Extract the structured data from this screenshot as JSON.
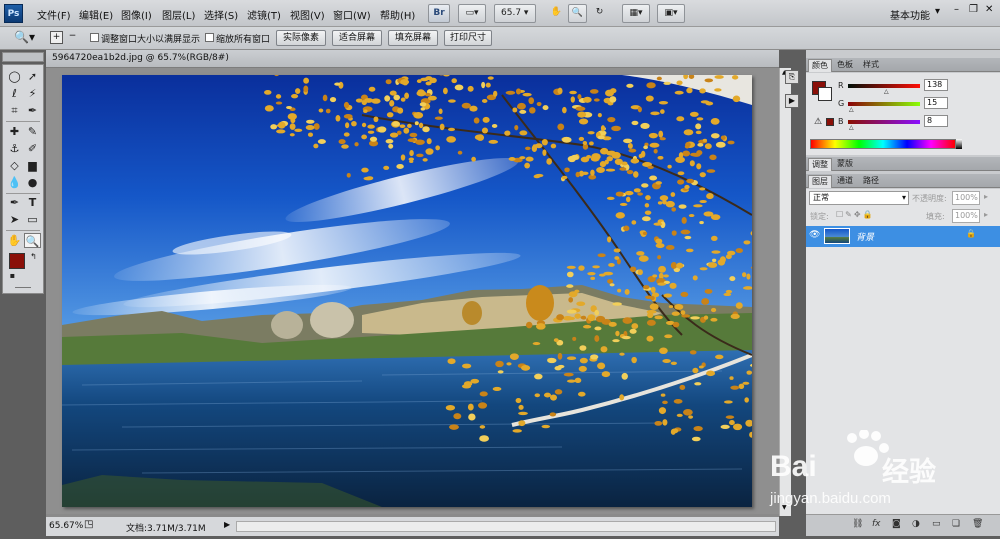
{
  "app": {
    "logo": "Ps"
  },
  "menu": [
    "文件(F)",
    "编辑(E)",
    "图像(I)",
    "图层(L)",
    "选择(S)",
    "滤镜(T)",
    "视图(V)",
    "窗口(W)",
    "帮助(H)"
  ],
  "appbar": {
    "bridge": "Br",
    "zoom": "65.7",
    "workspace": "基本功能"
  },
  "options": {
    "resize_windows": "调整窗口大小以满屏显示",
    "zoom_all": "缩放所有窗口",
    "actual_pixels": "实际像素",
    "fit_screen": "适合屏幕",
    "fill_screen": "填充屏幕",
    "print_size": "打印尺寸"
  },
  "document": {
    "tab_title": "5964720ea1b2d.jpg @ 65.7%(RGB/8#)"
  },
  "status": {
    "zoom": "65.67%",
    "doc": "文档:3.71M/3.71M"
  },
  "color_panel": {
    "tabs": [
      "颜色",
      "色板",
      "样式"
    ],
    "r_label": "R",
    "g_label": "G",
    "b_label": "B",
    "r": "138",
    "g": "15",
    "b": "8",
    "foreground": "#8a0f08"
  },
  "adjust_panel": {
    "tabs": [
      "调整",
      "蒙版"
    ]
  },
  "layers_panel": {
    "tabs": [
      "图层",
      "通道",
      "路径"
    ],
    "blend_mode": "正常",
    "opacity_label": "不透明度:",
    "opacity": "100%",
    "lock_label": "锁定:",
    "fill_label": "填充:",
    "fill": "100%",
    "layer_name": "背景"
  },
  "watermark": {
    "brand": "Bai",
    "brand2": "经验",
    "url": "jingyan.baidu.com"
  },
  "colors": {
    "accent": "#3399ff",
    "layer_selected": "#3d8fe3"
  }
}
